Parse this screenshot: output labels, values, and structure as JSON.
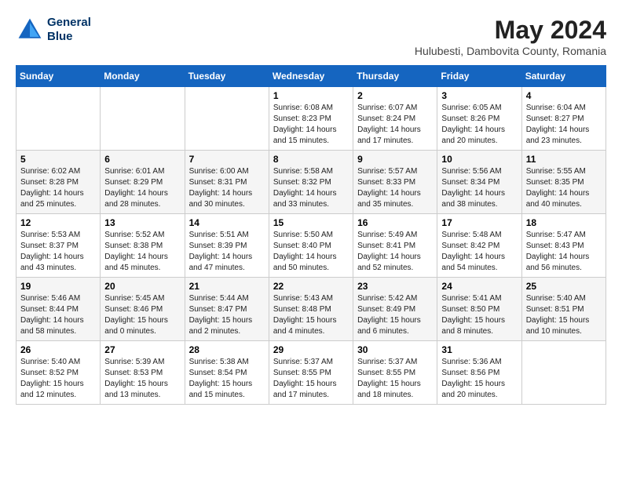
{
  "header": {
    "logo_line1": "General",
    "logo_line2": "Blue",
    "title": "May 2024",
    "location": "Hulubesti, Dambovita County, Romania"
  },
  "weekdays": [
    "Sunday",
    "Monday",
    "Tuesday",
    "Wednesday",
    "Thursday",
    "Friday",
    "Saturday"
  ],
  "weeks": [
    [
      {
        "day": "",
        "info": ""
      },
      {
        "day": "",
        "info": ""
      },
      {
        "day": "",
        "info": ""
      },
      {
        "day": "1",
        "info": "Sunrise: 6:08 AM\nSunset: 8:23 PM\nDaylight: 14 hours\nand 15 minutes."
      },
      {
        "day": "2",
        "info": "Sunrise: 6:07 AM\nSunset: 8:24 PM\nDaylight: 14 hours\nand 17 minutes."
      },
      {
        "day": "3",
        "info": "Sunrise: 6:05 AM\nSunset: 8:26 PM\nDaylight: 14 hours\nand 20 minutes."
      },
      {
        "day": "4",
        "info": "Sunrise: 6:04 AM\nSunset: 8:27 PM\nDaylight: 14 hours\nand 23 minutes."
      }
    ],
    [
      {
        "day": "5",
        "info": "Sunrise: 6:02 AM\nSunset: 8:28 PM\nDaylight: 14 hours\nand 25 minutes."
      },
      {
        "day": "6",
        "info": "Sunrise: 6:01 AM\nSunset: 8:29 PM\nDaylight: 14 hours\nand 28 minutes."
      },
      {
        "day": "7",
        "info": "Sunrise: 6:00 AM\nSunset: 8:31 PM\nDaylight: 14 hours\nand 30 minutes."
      },
      {
        "day": "8",
        "info": "Sunrise: 5:58 AM\nSunset: 8:32 PM\nDaylight: 14 hours\nand 33 minutes."
      },
      {
        "day": "9",
        "info": "Sunrise: 5:57 AM\nSunset: 8:33 PM\nDaylight: 14 hours\nand 35 minutes."
      },
      {
        "day": "10",
        "info": "Sunrise: 5:56 AM\nSunset: 8:34 PM\nDaylight: 14 hours\nand 38 minutes."
      },
      {
        "day": "11",
        "info": "Sunrise: 5:55 AM\nSunset: 8:35 PM\nDaylight: 14 hours\nand 40 minutes."
      }
    ],
    [
      {
        "day": "12",
        "info": "Sunrise: 5:53 AM\nSunset: 8:37 PM\nDaylight: 14 hours\nand 43 minutes."
      },
      {
        "day": "13",
        "info": "Sunrise: 5:52 AM\nSunset: 8:38 PM\nDaylight: 14 hours\nand 45 minutes."
      },
      {
        "day": "14",
        "info": "Sunrise: 5:51 AM\nSunset: 8:39 PM\nDaylight: 14 hours\nand 47 minutes."
      },
      {
        "day": "15",
        "info": "Sunrise: 5:50 AM\nSunset: 8:40 PM\nDaylight: 14 hours\nand 50 minutes."
      },
      {
        "day": "16",
        "info": "Sunrise: 5:49 AM\nSunset: 8:41 PM\nDaylight: 14 hours\nand 52 minutes."
      },
      {
        "day": "17",
        "info": "Sunrise: 5:48 AM\nSunset: 8:42 PM\nDaylight: 14 hours\nand 54 minutes."
      },
      {
        "day": "18",
        "info": "Sunrise: 5:47 AM\nSunset: 8:43 PM\nDaylight: 14 hours\nand 56 minutes."
      }
    ],
    [
      {
        "day": "19",
        "info": "Sunrise: 5:46 AM\nSunset: 8:44 PM\nDaylight: 14 hours\nand 58 minutes."
      },
      {
        "day": "20",
        "info": "Sunrise: 5:45 AM\nSunset: 8:46 PM\nDaylight: 15 hours\nand 0 minutes."
      },
      {
        "day": "21",
        "info": "Sunrise: 5:44 AM\nSunset: 8:47 PM\nDaylight: 15 hours\nand 2 minutes."
      },
      {
        "day": "22",
        "info": "Sunrise: 5:43 AM\nSunset: 8:48 PM\nDaylight: 15 hours\nand 4 minutes."
      },
      {
        "day": "23",
        "info": "Sunrise: 5:42 AM\nSunset: 8:49 PM\nDaylight: 15 hours\nand 6 minutes."
      },
      {
        "day": "24",
        "info": "Sunrise: 5:41 AM\nSunset: 8:50 PM\nDaylight: 15 hours\nand 8 minutes."
      },
      {
        "day": "25",
        "info": "Sunrise: 5:40 AM\nSunset: 8:51 PM\nDaylight: 15 hours\nand 10 minutes."
      }
    ],
    [
      {
        "day": "26",
        "info": "Sunrise: 5:40 AM\nSunset: 8:52 PM\nDaylight: 15 hours\nand 12 minutes."
      },
      {
        "day": "27",
        "info": "Sunrise: 5:39 AM\nSunset: 8:53 PM\nDaylight: 15 hours\nand 13 minutes."
      },
      {
        "day": "28",
        "info": "Sunrise: 5:38 AM\nSunset: 8:54 PM\nDaylight: 15 hours\nand 15 minutes."
      },
      {
        "day": "29",
        "info": "Sunrise: 5:37 AM\nSunset: 8:55 PM\nDaylight: 15 hours\nand 17 minutes."
      },
      {
        "day": "30",
        "info": "Sunrise: 5:37 AM\nSunset: 8:55 PM\nDaylight: 15 hours\nand 18 minutes."
      },
      {
        "day": "31",
        "info": "Sunrise: 5:36 AM\nSunset: 8:56 PM\nDaylight: 15 hours\nand 20 minutes."
      },
      {
        "day": "",
        "info": ""
      }
    ]
  ]
}
